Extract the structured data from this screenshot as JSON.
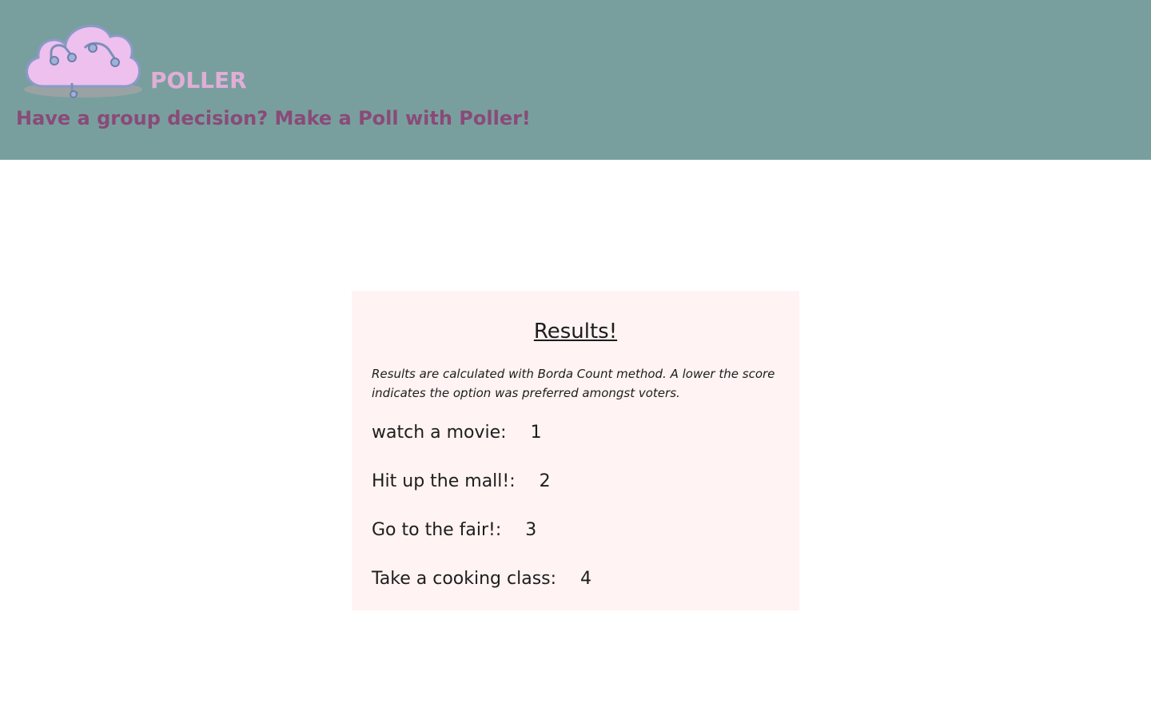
{
  "header": {
    "brand": "POLLER",
    "tagline": "Have a group decision? Make a Poll with Poller!",
    "logo_icon": "cloud-circuit-icon",
    "colors": {
      "background": "#789f9e",
      "brand": "#e0aed6",
      "tagline": "#8a4a78"
    }
  },
  "results": {
    "title": "Results!",
    "note": "Results are calculated with Borda Count method. A lower the score indicates the option was preferred amongst voters.",
    "items": [
      {
        "label": "watch a movie:",
        "score": "1"
      },
      {
        "label": "Hit up the mall!:",
        "score": "2"
      },
      {
        "label": "Go to the fair!:",
        "score": "3"
      },
      {
        "label": "Take a cooking class:",
        "score": "4"
      }
    ],
    "colors": {
      "card_background": "#fff3f3"
    }
  }
}
